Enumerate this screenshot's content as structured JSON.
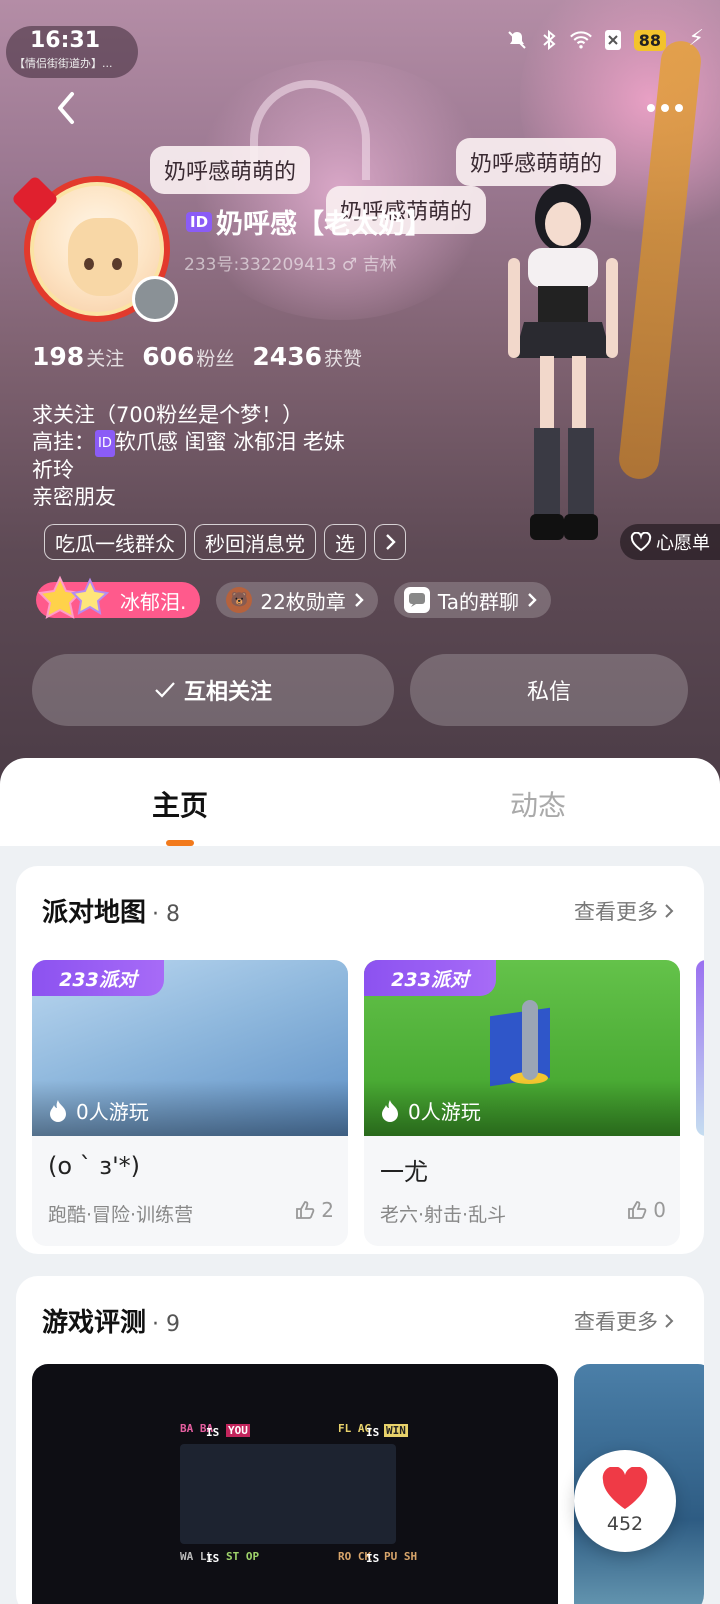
{
  "status_bar": {
    "time": "16:31",
    "subtitle": "【情侣街街道办】...",
    "battery": "88"
  },
  "profile": {
    "name": "奶呼感【老太奶】",
    "id_badge": "ID",
    "sub_id": "233号:332209413 ♂ 吉林",
    "stats": [
      {
        "num": "198",
        "label": "关注"
      },
      {
        "num": "606",
        "label": "粉丝"
      },
      {
        "num": "2436",
        "label": "获赞"
      }
    ],
    "bio_line1": "求关注（700粉丝是个梦！）",
    "bio_line2_prefix": "高挂：",
    "bio_line2_rest": "软爪感 闺蜜 冰郁泪 老妹",
    "bio_line3": "祈玲",
    "bio_line4": "亲密朋友",
    "tags": [
      "吃瓜一线群众",
      "秒回消息党",
      "选"
    ],
    "wishlist": "心愿单",
    "medal_chip": "冰郁泪.",
    "badges_chip": "22枚勋章",
    "group_chip": "Ta的群聊",
    "follow_button": "互相关注",
    "message_button": "私信"
  },
  "bubbles": [
    "奶呼感萌萌的",
    "奶呼感萌萌的",
    "奶呼感萌萌的"
  ],
  "tabs": {
    "home": "主页",
    "feed": "动态"
  },
  "party_maps": {
    "title": "派对地图",
    "count": "· 8",
    "see_more": "查看更多",
    "brand": "233派对",
    "items": [
      {
        "players": "0人游玩",
        "name": "(o ` з'*)",
        "category": "跑酷·冒险·训练营",
        "likes": "2"
      },
      {
        "players": "0人游玩",
        "name": "一尤",
        "category": "老六·射击·乱斗",
        "likes": "0"
      }
    ]
  },
  "game_reviews": {
    "title": "游戏评测",
    "count": "· 9",
    "see_more": "查看更多",
    "pixel_labels": {
      "baba": "BA BA",
      "is": "IS",
      "you": "YOU",
      "flag": "FL AG",
      "win": "WIN",
      "wall": "WA LL",
      "stop": "ST OP",
      "rock": "RO CK",
      "push": "PU SH"
    }
  },
  "floating_like": {
    "count": "452"
  },
  "colors": {
    "accent_orange": "#f27a1c",
    "brand_purple": "#8c52f0",
    "medal_pink": "#ff5a8c"
  }
}
